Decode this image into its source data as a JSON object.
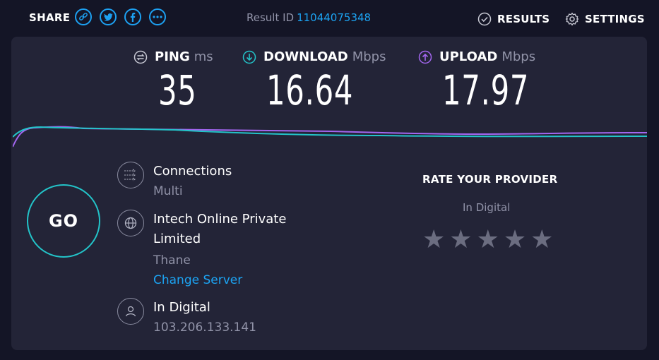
{
  "header": {
    "share_label": "SHARE",
    "share_buttons": [
      "link-icon",
      "twitter-icon",
      "facebook-icon",
      "more-icon"
    ],
    "result_id_label": "Result ID",
    "result_id_value": "11044075348",
    "nav": {
      "results": "RESULTS",
      "settings": "SETTINGS"
    }
  },
  "metrics": {
    "ping": {
      "label": "PING",
      "unit": "ms",
      "value": "35"
    },
    "download": {
      "label": "DOWNLOAD",
      "unit": "Mbps",
      "value": "16.64"
    },
    "upload": {
      "label": "UPLOAD",
      "unit": "Mbps",
      "value": "17.97"
    }
  },
  "go_label": "GO",
  "connections": {
    "title": "Connections",
    "value": "Multi"
  },
  "server": {
    "name": "Intech Online Private Limited",
    "location": "Thane",
    "change_label": "Change Server"
  },
  "isp": {
    "name": "In Digital",
    "ip": "103.206.133.141"
  },
  "rating": {
    "title": "RATE YOUR PROVIDER",
    "provider": "In Digital",
    "stars": 5
  },
  "colors": {
    "accent": "#1ca4f3",
    "download": "#23c4c9",
    "upload": "#a366f0",
    "panel": "#232437",
    "background": "#141526"
  }
}
